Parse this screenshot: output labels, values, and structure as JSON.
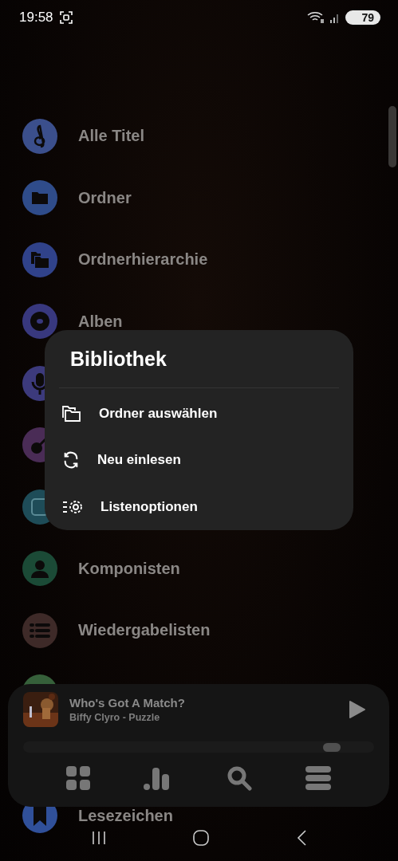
{
  "status_bar": {
    "time": "19:58",
    "battery": "79"
  },
  "library_items": [
    {
      "label": "Alle Titel",
      "color": "#3b4f8c"
    },
    {
      "label": "Ordner",
      "color": "#2f4c8a"
    },
    {
      "label": "Ordnerhierarchie",
      "color": "#30428a"
    },
    {
      "label": "Alben",
      "color": "#38387e"
    },
    {
      "color": "#3c3a7c"
    },
    {
      "color": "#4a2c56"
    },
    {
      "color": "#1e4c58"
    },
    {
      "label": "Komponisten",
      "color": "#1b4a36"
    },
    {
      "label": "Wiedergabelisten",
      "color": "#3e2a28"
    },
    {
      "color": "#36603a"
    }
  ],
  "bottom_items": [
    {
      "label": "Lesezeichen",
      "color": "#30509a"
    }
  ],
  "popup": {
    "title": "Bibliothek",
    "items": [
      {
        "label": "Ordner auswählen"
      },
      {
        "label": "Neu einlesen"
      },
      {
        "label": "Listenoptionen"
      }
    ]
  },
  "player": {
    "title": "Who's Got A Match?",
    "subtitle": "Biffy Clyro - Puzzle",
    "level": 0.88
  }
}
